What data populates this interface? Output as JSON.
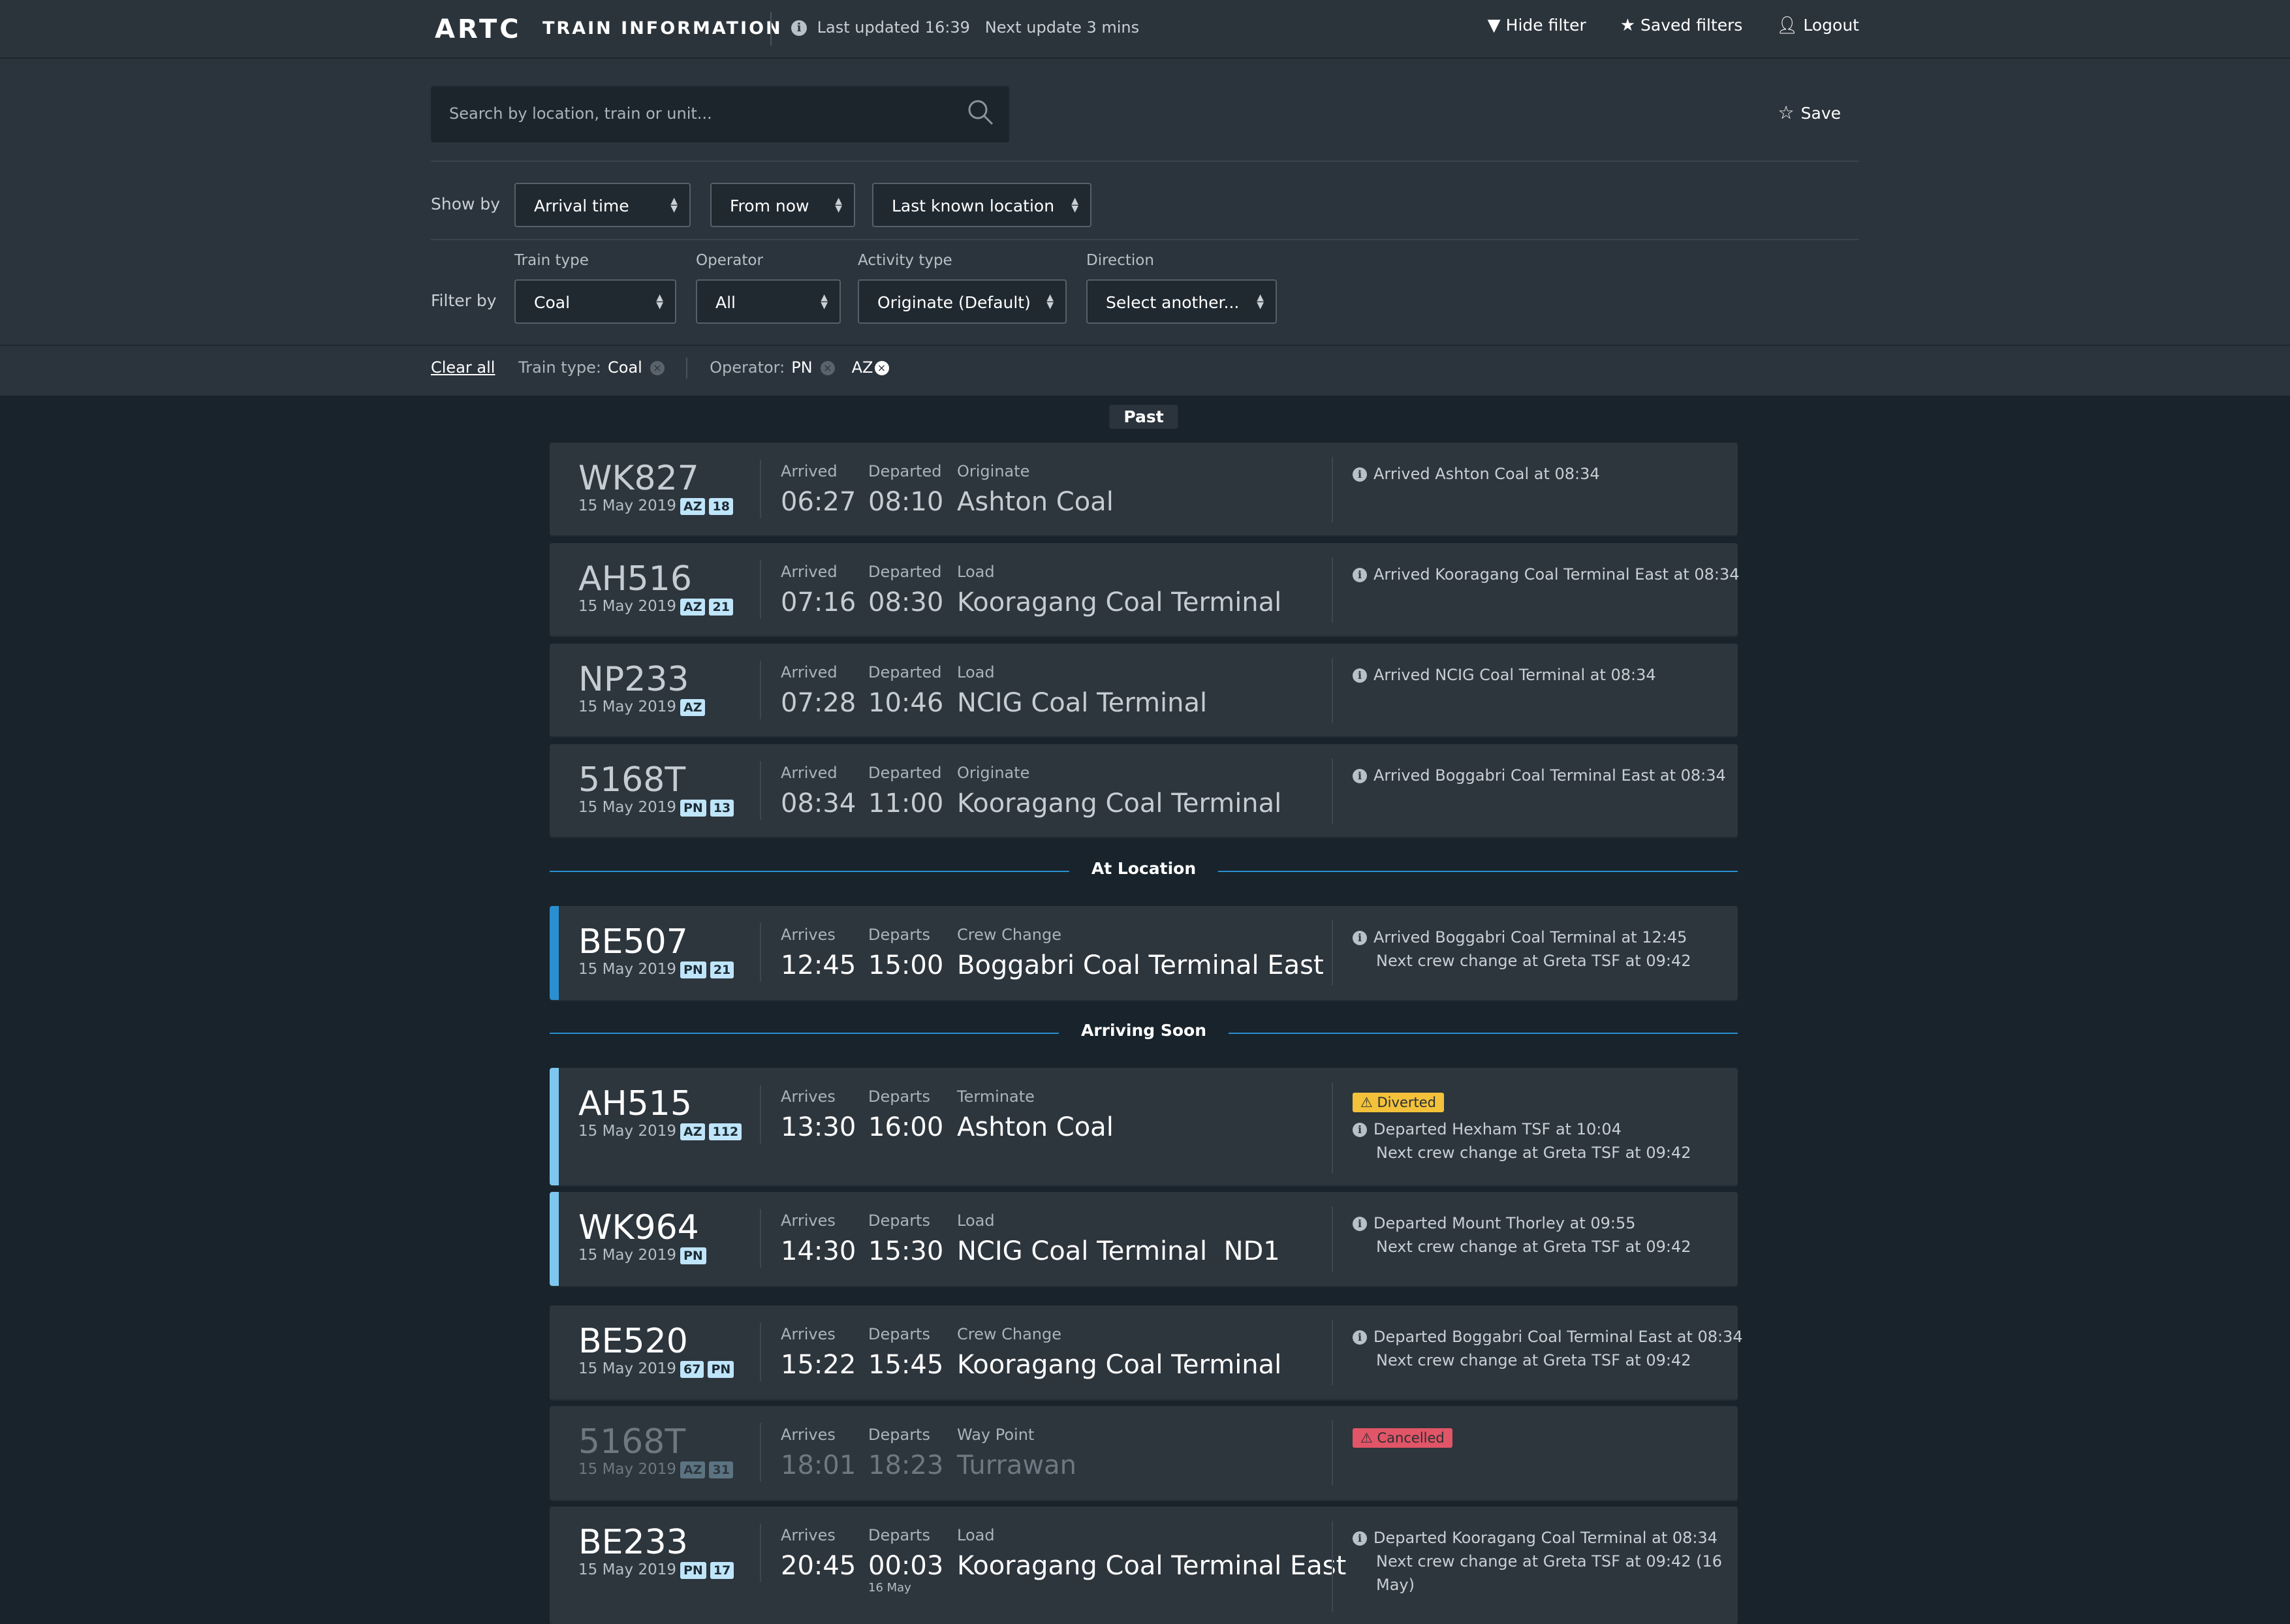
{
  "header": {
    "logo": "ARTC",
    "app_title": "TRAIN INFORMATION",
    "updated": "Last updated 16:39   Next update 3 mins",
    "nav": [
      {
        "icon": "filter-icon",
        "label": "Hide filter"
      },
      {
        "icon": "star-icon",
        "label": "Saved filters"
      },
      {
        "icon": "user-icon",
        "label": "Logout"
      }
    ]
  },
  "search": {
    "placeholder": "Search by location, train or unit...",
    "save_label": "Save"
  },
  "show_by": {
    "label": "Show by",
    "selects": [
      "Arrival time",
      "From now",
      "Last known location"
    ]
  },
  "filter_by": {
    "label": "Filter by",
    "fields": [
      {
        "label": "Train type",
        "value": "Coal"
      },
      {
        "label": "Operator",
        "value": "All"
      },
      {
        "label": "Activity type",
        "value": "Originate (Default)"
      },
      {
        "label": "Direction",
        "value": "Select another..."
      }
    ]
  },
  "active_filters": {
    "clear_all": "Clear all",
    "train_type_label": "Train type:",
    "train_type_value": "Coal",
    "operator_label": "Operator:",
    "operator_values": [
      "PN",
      "AZ"
    ]
  },
  "sections": {
    "past": "Past",
    "at_location": "At Location",
    "arriving_soon": "Arriving Soon"
  },
  "rows": [
    {
      "id": "WK827",
      "date": "15 May 2019",
      "badges": [
        "AZ",
        "18"
      ],
      "t1_label": "Arrived",
      "t1": "06:27",
      "t2_label": "Departed",
      "t2": "08:10",
      "activity": "Originate",
      "location": "Ashton Coal",
      "notes": [
        "Arrived Ashton Coal at 08:34"
      ]
    },
    {
      "id": "AH516",
      "date": "15 May 2019",
      "badges": [
        "AZ",
        "21"
      ],
      "t1_label": "Arrived",
      "t1": "07:16",
      "t2_label": "Departed",
      "t2": "08:30",
      "activity": "Load",
      "location": "Kooragang Coal Terminal",
      "notes": [
        "Arrived Kooragang Coal Terminal East at 08:34"
      ]
    },
    {
      "id": "NP233",
      "date": "15 May 2019",
      "badges": [
        "AZ"
      ],
      "t1_label": "Arrived",
      "t1": "07:28",
      "t2_label": "Departed",
      "t2": "10:46",
      "activity": "Load",
      "location": "NCIG Coal Terminal",
      "notes": [
        "Arrived NCIG Coal Terminal at 08:34"
      ]
    },
    {
      "id": "5168T",
      "date": "15 May 2019",
      "badges": [
        "PN",
        "13"
      ],
      "t1_label": "Arrived",
      "t1": "08:34",
      "t2_label": "Departed",
      "t2": "11:00",
      "activity": "Originate",
      "location": "Kooragang Coal Terminal",
      "notes": [
        "Arrived Boggabri Coal Terminal East at 08:34"
      ]
    },
    {
      "id": "BE507",
      "date": "15 May 2019",
      "badges": [
        "PN",
        "21"
      ],
      "t1_label": "Arrives",
      "t1": "12:45",
      "t2_label": "Departs",
      "t2": "15:00",
      "activity": "Crew Change",
      "location": "Boggabri Coal Terminal East",
      "notes": [
        "Arrived Boggabri Coal Terminal at 12:45",
        "Next crew change at Greta TSF at 09:42"
      ]
    },
    {
      "id": "AH515",
      "date": "15 May 2019",
      "badges": [
        "AZ",
        "112"
      ],
      "t1_label": "Arrives",
      "t1": "13:30",
      "t2_label": "Departs",
      "t2": "16:00",
      "activity": "Terminate",
      "location": "Ashton Coal",
      "status": "Diverted",
      "notes": [
        "Departed Hexham TSF at 10:04",
        "Next crew change at Greta TSF at 09:42"
      ]
    },
    {
      "id": "WK964",
      "date": "15 May 2019",
      "badges": [
        "PN"
      ],
      "t1_label": "Arrives",
      "t1": "14:30",
      "t2_label": "Departs",
      "t2": "15:30",
      "activity": "Load",
      "location": "NCIG Coal Terminal  ND1",
      "notes": [
        "Departed Mount Thorley at 09:55",
        "Next crew change at Greta TSF at 09:42"
      ]
    },
    {
      "id": "BE520",
      "date": "15 May 2019",
      "badges": [
        "67",
        "PN"
      ],
      "t1_label": "Arrives",
      "t1": "15:22",
      "t2_label": "Departs",
      "t2": "15:45",
      "activity": "Crew Change",
      "location": "Kooragang Coal Terminal",
      "notes": [
        "Departed Boggabri Coal Terminal East at 08:34",
        "Next crew change at Greta TSF at 09:42"
      ]
    },
    {
      "id": "5168T",
      "date": "15 May 2019",
      "badges": [
        "AZ",
        "31"
      ],
      "t1_label": "Arrives",
      "t1": "18:01",
      "t2_label": "Departs",
      "t2": "18:23",
      "activity": "Way Point",
      "location": "Turrawan",
      "status": "Cancelled",
      "notes": []
    },
    {
      "id": "BE233",
      "date": "15 May 2019",
      "badges": [
        "PN",
        "17"
      ],
      "t1_label": "Arrives",
      "t1": "20:45",
      "t2_label": "Departs",
      "t2": "00:03",
      "t2_sub": "16 May",
      "activity": "Load",
      "location": "Kooragang Coal Terminal East",
      "notes": [
        "Departed Kooragang Coal Terminal at 08:34",
        "Next crew change at Greta TSF at 09:42 (16",
        "May)"
      ]
    }
  ],
  "colors": {
    "accent_blue": "#2a8fd1",
    "accent_light": "#7ec8ef",
    "diverted": "#f3c13a",
    "cancelled": "#e05567"
  }
}
